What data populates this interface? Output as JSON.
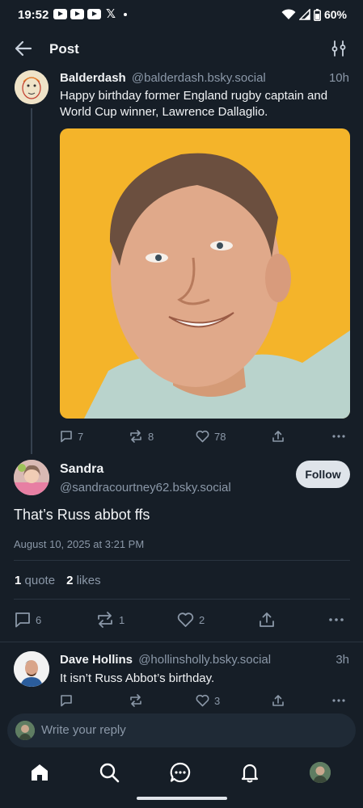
{
  "status_bar": {
    "time": "19:52",
    "notification_icons": [
      "youtube-icon",
      "youtube-icon",
      "youtube-icon",
      "x-icon",
      "dot-icon"
    ],
    "x_glyph": "𝕏",
    "battery": "60%"
  },
  "header": {
    "title": "Post"
  },
  "parent_post": {
    "author_name": "Balderdash",
    "author_handle": "@balderdash.bsky.social",
    "time": "10h",
    "text": "Happy birthday former England rugby captain and World Cup winner, Lawrence Dallaglio.",
    "image_background": "#f4b42a",
    "actions": {
      "replies": "7",
      "reposts": "8",
      "likes": "78"
    }
  },
  "focus_post": {
    "author_name": "Sandra",
    "author_handle": "@sandracourtney62.bsky.social",
    "follow_label": "Follow",
    "text": "That’s Russ abbot ffs",
    "date": "August 10, 2025 at 3:21 PM",
    "quotes_count": "1",
    "quotes_label": "quote",
    "likes_count": "2",
    "likes_label": "likes",
    "actions": {
      "replies": "6",
      "reposts": "1",
      "likes": "2"
    }
  },
  "reply": {
    "author_name": "Dave Hollins",
    "author_handle": "@hollinsholly.bsky.social",
    "time": "3h",
    "text": "It isn’t Russ Abbot’s birthday.",
    "actions": {
      "replies": "",
      "reposts": "",
      "likes": "3"
    }
  },
  "composer": {
    "placeholder": "Write your reply"
  },
  "bottom_nav": [
    "home-icon",
    "search-icon",
    "chat-icon",
    "bell-icon",
    "profile-avatar"
  ],
  "colors": {
    "background": "#161e27",
    "muted_text": "#8b98a8",
    "follow_button": "#dfe4ea",
    "divider": "#2a3440"
  }
}
